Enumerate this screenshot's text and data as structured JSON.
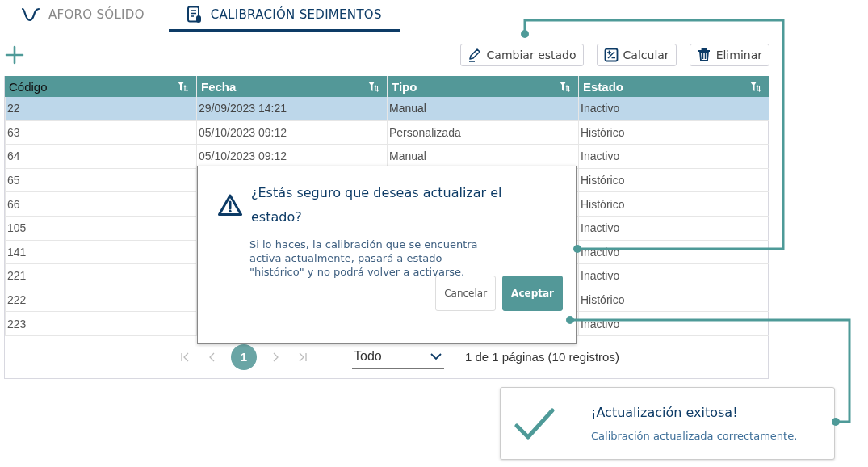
{
  "tabs": [
    {
      "label": "AFORO SÓLIDO",
      "kind": "wave",
      "selected": false
    },
    {
      "label": "CALIBRACIÓN SEDIMENTOS",
      "kind": "doc",
      "selected": true
    }
  ],
  "actions": [
    {
      "label": "Cambiar estado",
      "kind": "edit"
    },
    {
      "label": "Calcular",
      "kind": "calc"
    },
    {
      "label": "Eliminar",
      "kind": "delete"
    }
  ],
  "table": {
    "columns": [
      "Código",
      "Fecha",
      "Tipo",
      "Estado"
    ],
    "rows": [
      {
        "codigo": "22",
        "fecha": "29/09/2023 14:21",
        "tipo": "Manual",
        "estado": "Inactivo",
        "selected": true
      },
      {
        "codigo": "63",
        "fecha": "05/10/2023 09:12",
        "tipo": "Personalizada",
        "estado": "Histórico",
        "selected": false
      },
      {
        "codigo": "64",
        "fecha": "05/10/2023 09:12",
        "tipo": "Manual",
        "estado": "Inactivo",
        "selected": false
      },
      {
        "codigo": "65",
        "estado": "Histórico",
        "selected": false
      },
      {
        "codigo": "66",
        "estado": "Histórico",
        "selected": false
      },
      {
        "codigo": "105",
        "estado": "Inactivo",
        "selected": false
      },
      {
        "codigo": "141",
        "estado": "Inactivo",
        "selected": false
      },
      {
        "codigo": "221",
        "estado": "Inactivo",
        "selected": false
      },
      {
        "codigo": "222",
        "estado": "Histórico",
        "selected": false
      },
      {
        "codigo": "223",
        "estado": "Inactivo",
        "selected": false
      }
    ]
  },
  "pagination": {
    "pages": [
      {
        "label": "1",
        "selected": true
      }
    ],
    "page_size": "Todo",
    "summary": "1 de 1 páginas (10 registros)"
  },
  "dialog": {
    "title": "¿Estás seguro que deseas actualizar el estado?",
    "message": "Si lo haces, la calibración que se encuentra activa actualmente, pasará a estado \"histórico\" y no podrá volver a activarse.",
    "buttons": [
      {
        "label": "Cancelar",
        "kind": "secondary"
      },
      {
        "label": "Aceptar",
        "kind": "primary"
      }
    ]
  },
  "toast": {
    "title": "¡Actualización exitosa!",
    "message": "Calibración actualizada correctamente."
  }
}
